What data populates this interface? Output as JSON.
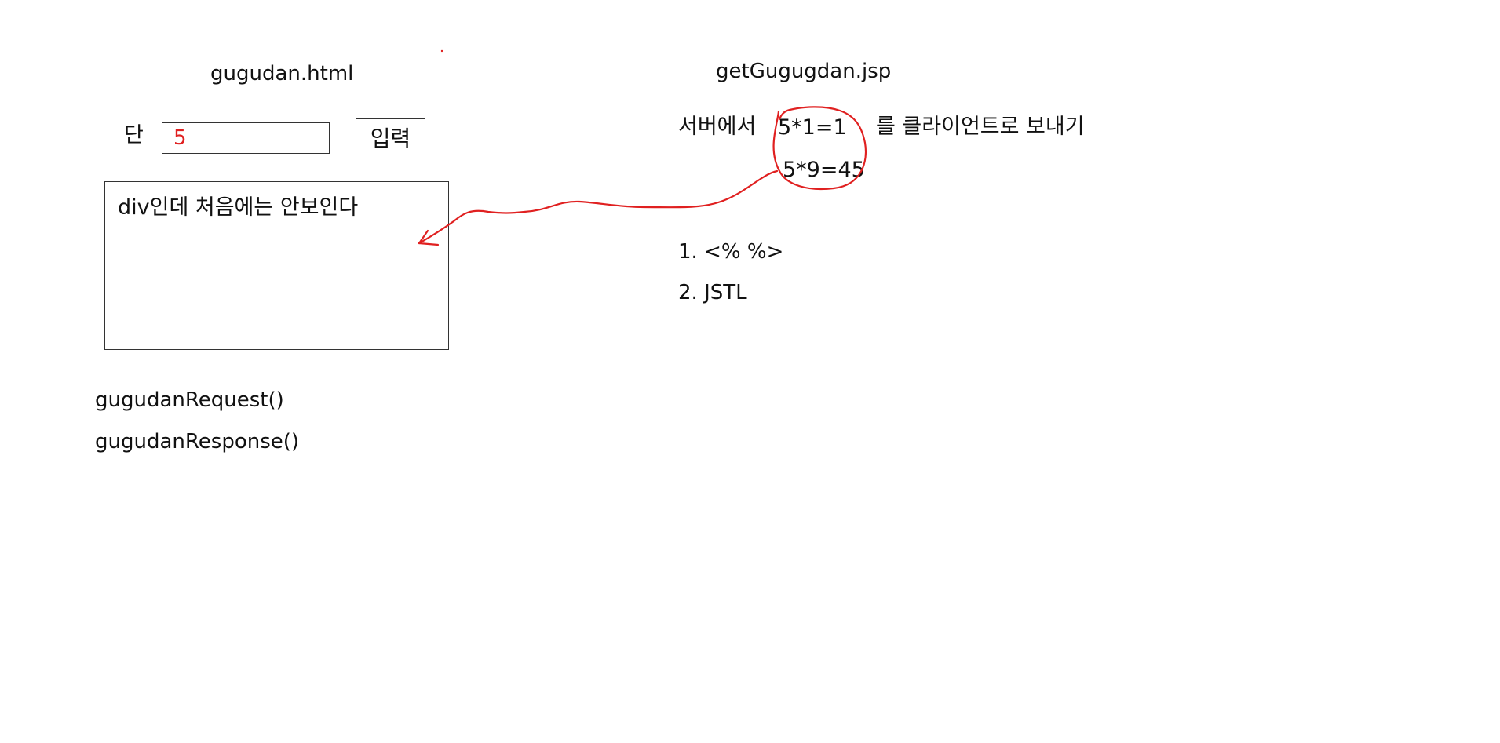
{
  "left": {
    "title": "gugudan.html",
    "dan_label": "단",
    "dan_input_value": "5",
    "input_button_label": "입력",
    "div_text": "div인데 처음에는 안보인다",
    "functions": [
      "gugudanRequest()",
      "gugudanResponse()"
    ]
  },
  "right": {
    "title": "getGugugdan.jsp",
    "send_prefix": "서버에서",
    "send_suffix": "를 클라이언트로 보내기",
    "expressions": [
      "5*1=1",
      "5*9=45"
    ],
    "methods": [
      "1.  <%   %>",
      "2. JSTL"
    ]
  },
  "colors": {
    "annotation": "#e02020",
    "text": "#111111",
    "border": "#333333"
  },
  "icons": {
    "arrow": "red-hand-drawn-arrow-icon",
    "circle": "red-hand-drawn-circle"
  }
}
